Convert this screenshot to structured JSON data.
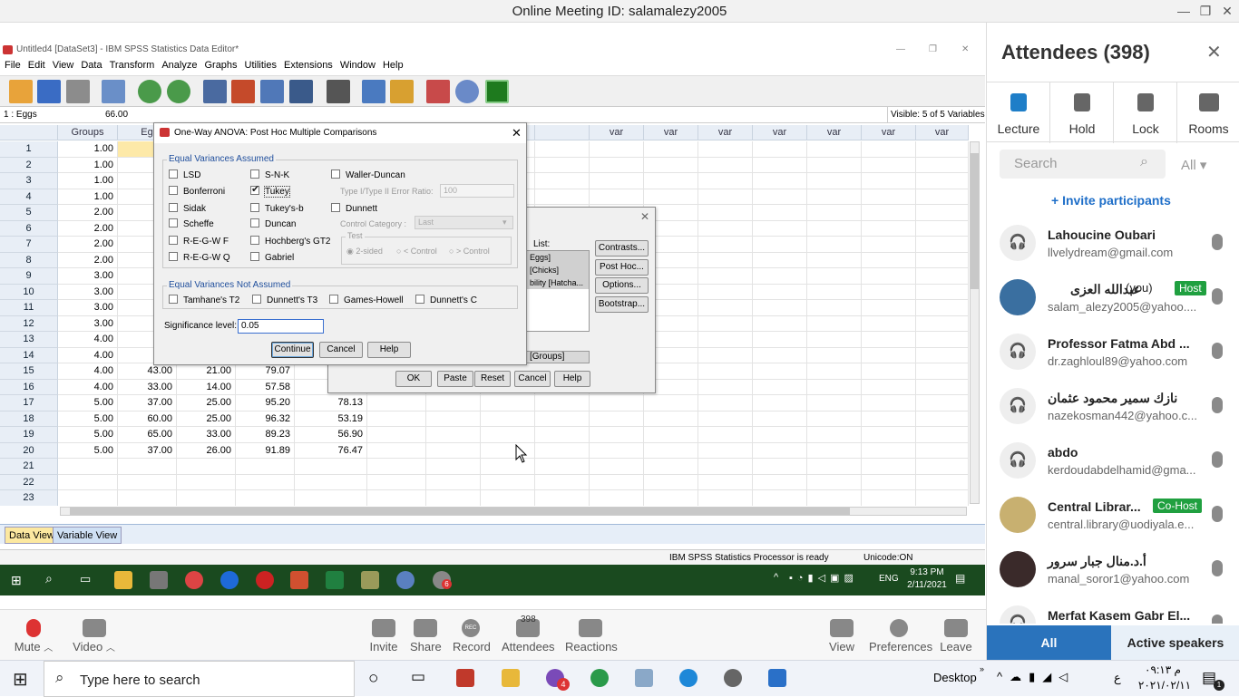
{
  "meeting_title": "Online Meeting ID: salamalezy2005",
  "spss": {
    "window_title": "Untitled4 [DataSet3] - IBM SPSS Statistics Data Editor*",
    "menu": [
      "File",
      "Edit",
      "View",
      "Data",
      "Transform",
      "Analyze",
      "Graphs",
      "Utilities",
      "Extensions",
      "Window",
      "Help"
    ],
    "cell_ref": "1 : Eggs",
    "cell_value": "66.00",
    "visible_vars": "Visible: 5 of 5 Variables",
    "col_headers": [
      "Groups",
      "Eg",
      "var",
      "var",
      "var",
      "var",
      "var",
      "var",
      "var",
      "var"
    ],
    "rows": [
      [
        "1",
        "1.00",
        "",
        "",
        "",
        ""
      ],
      [
        "2",
        "1.00",
        "",
        "",
        "",
        ""
      ],
      [
        "3",
        "1.00",
        "",
        "",
        "",
        ""
      ],
      [
        "4",
        "1.00",
        "",
        "",
        "",
        ""
      ],
      [
        "5",
        "2.00",
        "",
        "",
        "",
        ""
      ],
      [
        "6",
        "2.00",
        "",
        "",
        "",
        ""
      ],
      [
        "7",
        "2.00",
        "",
        "",
        "",
        ""
      ],
      [
        "8",
        "2.00",
        "",
        "",
        "",
        ""
      ],
      [
        "9",
        "3.00",
        "",
        "",
        "",
        ""
      ],
      [
        "10",
        "3.00",
        "",
        "",
        "",
        ""
      ],
      [
        "11",
        "3.00",
        "",
        "",
        "",
        ""
      ],
      [
        "12",
        "3.00",
        "",
        "",
        "",
        ""
      ],
      [
        "13",
        "4.00",
        "",
        "",
        "",
        ""
      ],
      [
        "14",
        "4.00",
        "",
        "",
        "",
        ""
      ],
      [
        "15",
        "4.00",
        "43.00",
        "21.00",
        "79.07",
        ""
      ],
      [
        "16",
        "4.00",
        "33.00",
        "14.00",
        "57.58",
        ""
      ],
      [
        "17",
        "5.00",
        "37.00",
        "25.00",
        "95.20",
        "78.13"
      ],
      [
        "18",
        "5.00",
        "60.00",
        "25.00",
        "96.32",
        "53.19"
      ],
      [
        "19",
        "5.00",
        "65.00",
        "33.00",
        "89.23",
        "56.90"
      ],
      [
        "20",
        "5.00",
        "37.00",
        "26.00",
        "91.89",
        "76.47"
      ],
      [
        "21",
        "",
        "",
        "",
        "",
        ""
      ],
      [
        "22",
        "",
        "",
        "",
        "",
        ""
      ],
      [
        "23",
        "",
        "",
        "",
        "",
        ""
      ]
    ],
    "tab_data": "Data View",
    "tab_var": "Variable View",
    "status_ready": "IBM SPSS Statistics Processor is ready",
    "status_unicode": "Unicode:ON"
  },
  "posthoc": {
    "title": "One-Way ANOVA: Post Hoc Multiple Comparisons",
    "eva_label": "Equal Variances Assumed",
    "c1": [
      "LSD",
      "Bonferroni",
      "Sidak",
      "Scheffe",
      "R-E-G-W F",
      "R-E-G-W Q"
    ],
    "c2": [
      "S-N-K",
      "Tukey",
      "Tukey's-b",
      "Duncan",
      "Hochberg's GT2",
      "Gabriel"
    ],
    "waller": "Waller-Duncan",
    "ratio_label": "Type I/Type II Error Ratio:",
    "ratio_value": "100",
    "dunnett": "Dunnett",
    "control_label": "Control Category :",
    "control_value": "Last",
    "test_label": "Test",
    "test_opts": [
      "2-sided",
      "< Control",
      "> Control"
    ],
    "evna_label": "Equal Variances Not Assumed",
    "nonequal": [
      "Tamhane's T2",
      "Dunnett's T3",
      "Games-Howell",
      "Dunnett's C"
    ],
    "sig_label": "Significance level:",
    "sig_value": "0.05",
    "btn_continue": "Continue",
    "btn_cancel": "Cancel",
    "btn_help": "Help"
  },
  "oneway": {
    "list_label": "List:",
    "list_items": [
      "Eggs]",
      "[Chicks]",
      "bility [Hatcha..."
    ],
    "factor": "[Groups]",
    "side_btns": [
      "Contrasts...",
      "Post Hoc...",
      "Options...",
      "Bootstrap..."
    ],
    "bottom_btns": [
      "OK",
      "Paste",
      "Reset",
      "Cancel",
      "Help"
    ]
  },
  "taskbar1": {
    "lang": "ENG",
    "time": "9:13 PM",
    "date": "2/11/2021",
    "badge": "6"
  },
  "meeting_bar": {
    "mute": "Mute",
    "video": "Video",
    "invite": "Invite",
    "share": "Share",
    "record": "Record",
    "attendees": "Attendees",
    "att_count": "398",
    "reactions": "Reactions",
    "view": "View",
    "prefs": "Preferences",
    "leave": "Leave",
    "rec_badge": "REC"
  },
  "attendees": {
    "title": "Attendees (398)",
    "actions": [
      "Lecture",
      "Hold",
      "Lock",
      "Rooms"
    ],
    "search_placeholder": "Search",
    "filter": "All",
    "invite": "Invite participants",
    "you": "(you)",
    "host": "Host",
    "cohost": "Co-Host",
    "list": [
      {
        "name": "Lahoucine Oubari",
        "email": "llvelydream@gmail.com"
      },
      {
        "name": "عبدالله العزى",
        "email": "salam_alezy2005@yahoo...."
      },
      {
        "name": "Professor Fatma Abd ...",
        "email": "dr.zaghloul89@yahoo.com"
      },
      {
        "name": "نازك سمير محمود عثمان",
        "email": "nazekosman442@yahoo.c..."
      },
      {
        "name": "abdo",
        "email": "kerdoudabdelhamid@gma..."
      },
      {
        "name": "Central Librar...",
        "email": "central.library@uodiyala.e..."
      },
      {
        "name": "أ.د.منال جبار سرور",
        "email": "manal_soror1@yahoo.com"
      },
      {
        "name": "Merfat Kasem Gabr El...",
        "email": ""
      }
    ],
    "tab_all": "All",
    "tab_active": "Active speakers"
  },
  "taskbar2": {
    "search_placeholder": "Type here to search",
    "desktop": "Desktop",
    "badge": "4",
    "lang": "ع",
    "time": "م ٠٩:١٣",
    "date": "٢٠٢١/٠٢/١١",
    "notif": "1"
  }
}
